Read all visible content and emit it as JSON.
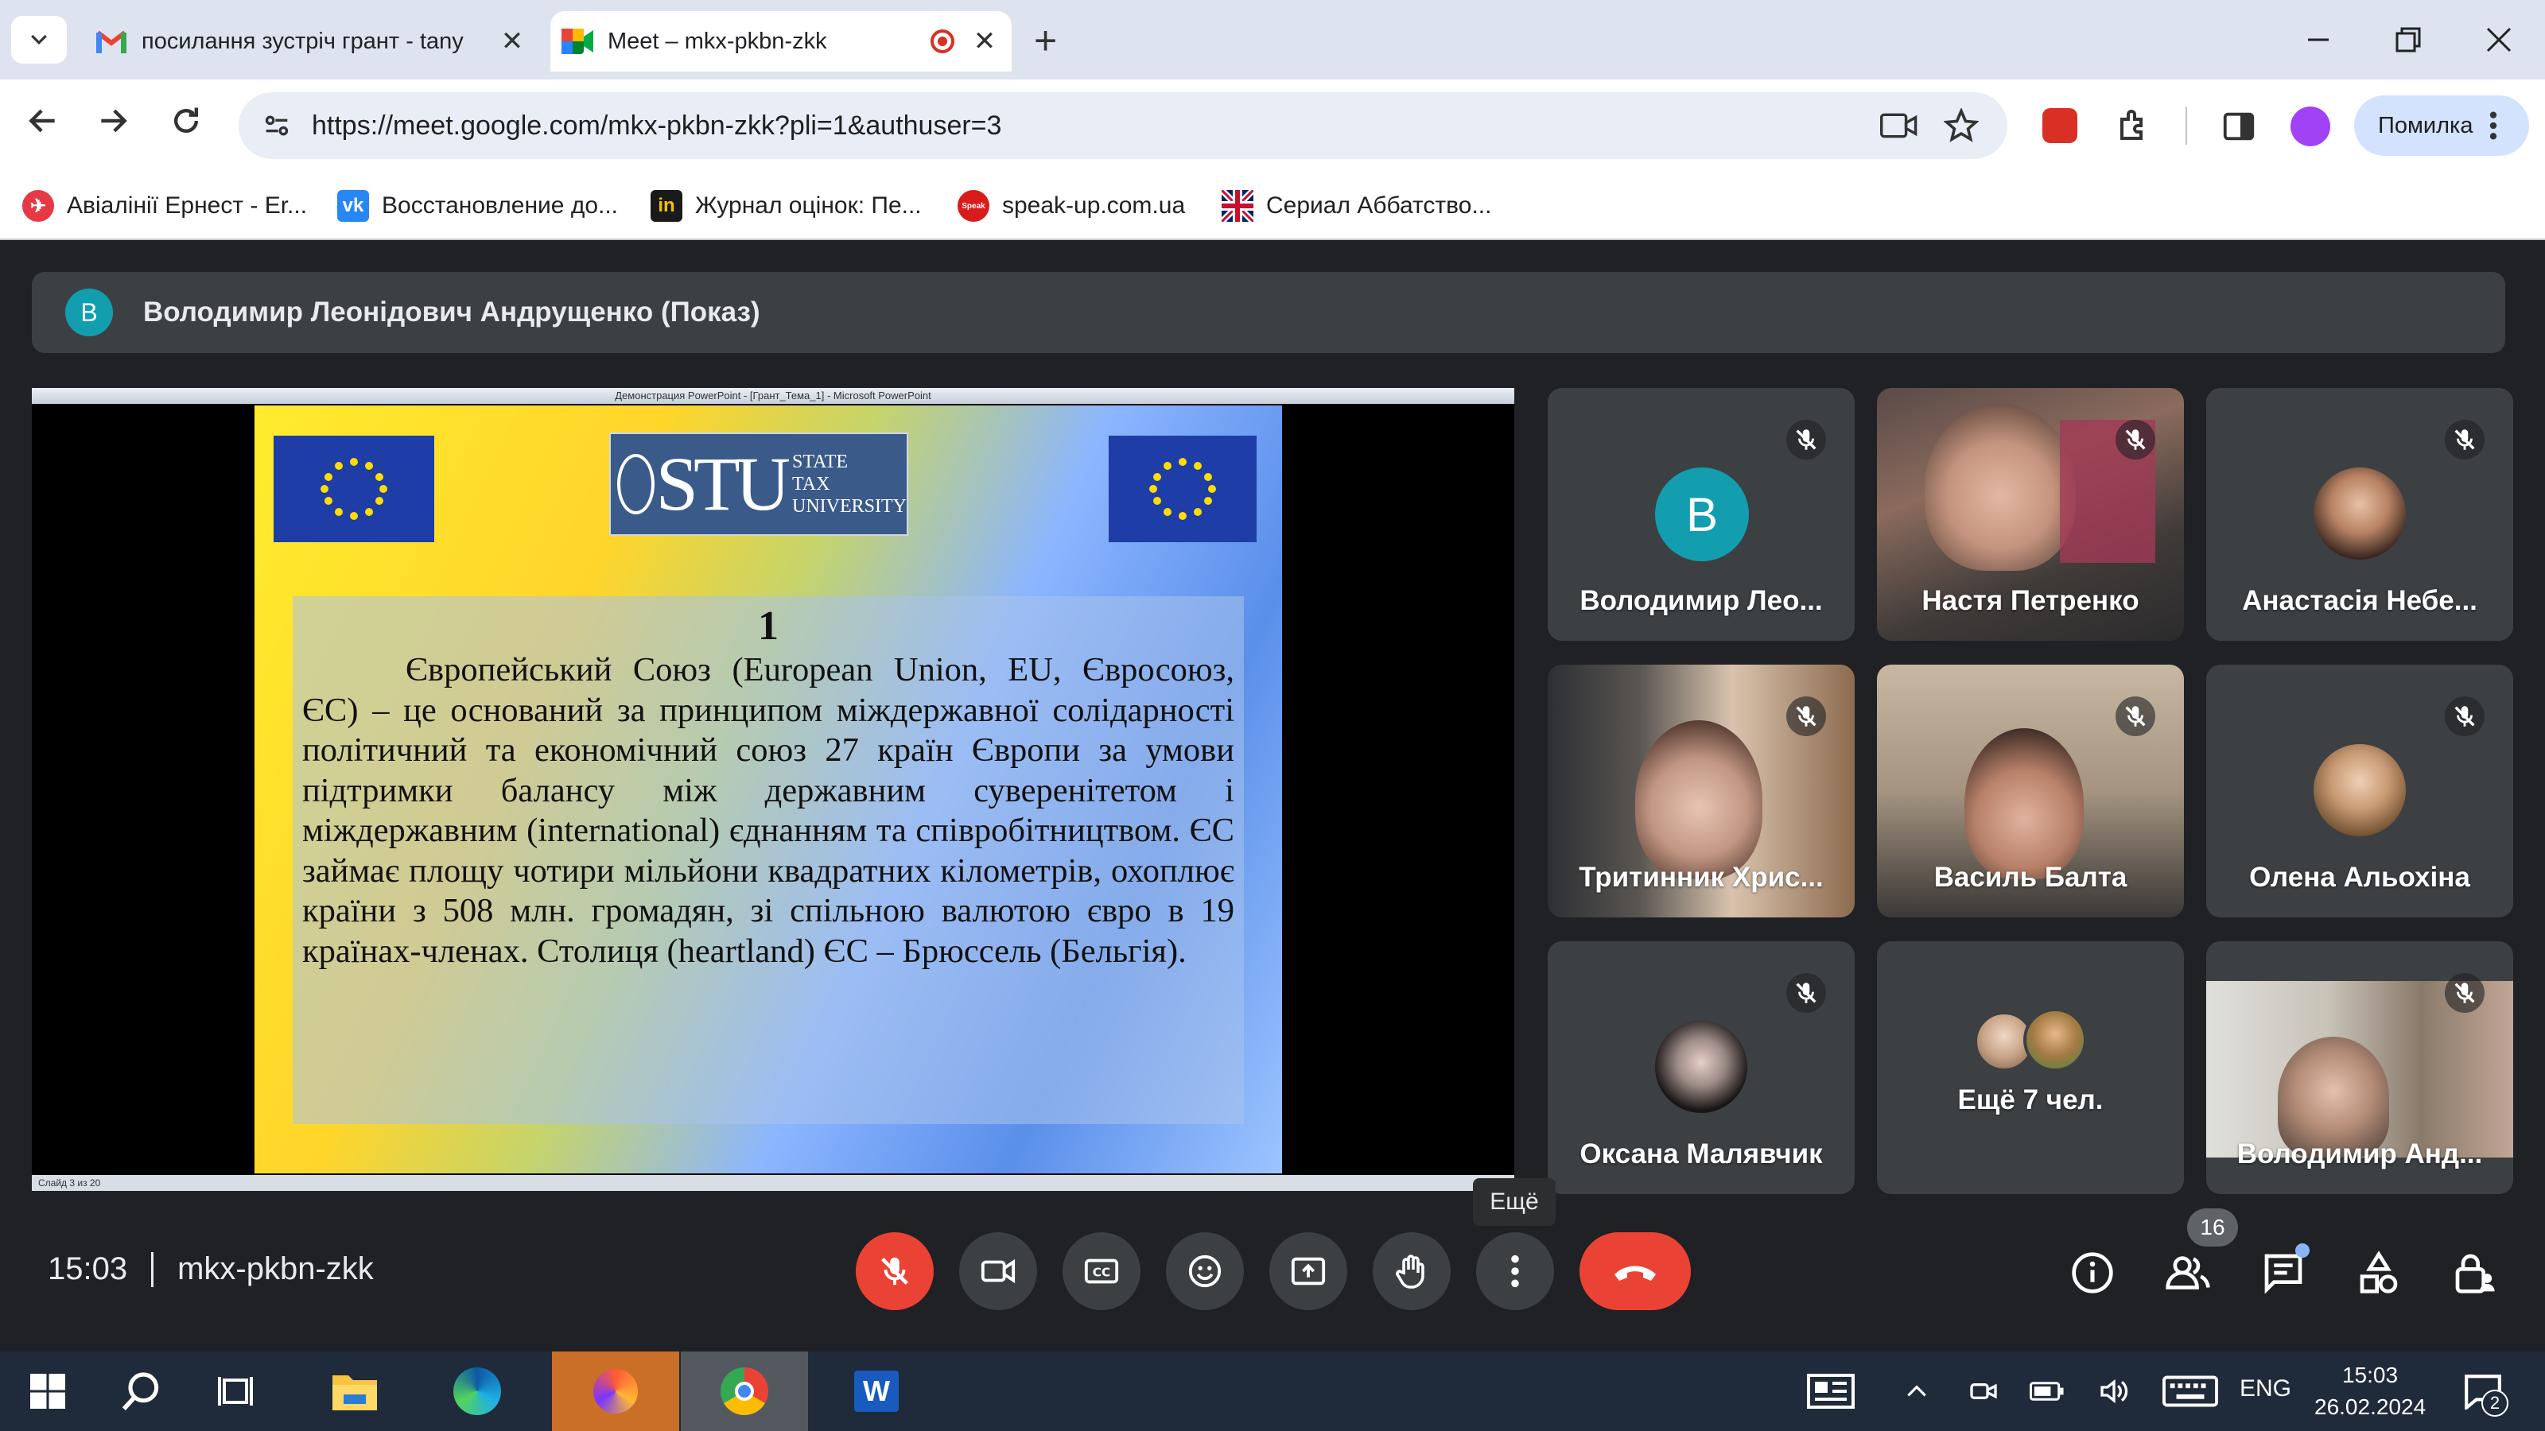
{
  "browser": {
    "tabs": [
      {
        "title": "посилання зустріч грант - tany",
        "close": "✕"
      },
      {
        "title": "Meet – mkx-pkbn-zkk",
        "close": "✕"
      }
    ],
    "new_tab": "+",
    "url": "https://meet.google.com/mkx-pkbn-zkk?pli=1&authuser=3",
    "profile_label": "Помилка",
    "bookmarks": [
      {
        "label": "Авіалінії Ернест - Er..."
      },
      {
        "label": "Восстановление до..."
      },
      {
        "label": "Журнал оцінок: Пе..."
      },
      {
        "label": "speak-up.com.ua"
      },
      {
        "label": "Сериал Аббатство..."
      }
    ]
  },
  "meet": {
    "presenter_avatar": "B",
    "presenter_title": "Володимир Леонідович Андрущенко (Показ)",
    "slide": {
      "window_title": "Демонстрация PowerPoint - [Грант_Тема_1] - Microsoft PowerPoint",
      "status_bar": "Слайд 3 из 20",
      "logo_letters": "STU",
      "logo_line1": "STATE",
      "logo_line2": "TAX",
      "logo_line3": "UNIVERSITY",
      "number": "1",
      "text": "Європейський Союз (European Union, EU, Євросоюз, ЄС) – це оснований за принципом міждержавної солідарності політичний та економічний союз 27 країн Європи за умови підтримки балансу між державним суверенітетом і міждержавним (international) єднанням та співробітництвом. ЄС займає площу чотири мільйони квадратних кілометрів, охоплює країни з 508 млн. громадян, зі спільною валютою євро в 19 країнах-членах. Столиця (heartland) ЄС – Брюссель (Бельгія)."
    },
    "participants": [
      {
        "name": "Володимир Лео...",
        "avatar": "B"
      },
      {
        "name": "Настя Петренко"
      },
      {
        "name": "Анастасія Небе..."
      },
      {
        "name": "Тритинник Хрис..."
      },
      {
        "name": "Василь Балта"
      },
      {
        "name": "Олена Альохіна"
      },
      {
        "name": "Оксана Малявчик"
      },
      {
        "name": "Ещё 7 чел."
      },
      {
        "name": "Володимир Анд..."
      }
    ],
    "time": "15:03",
    "meeting_code": "mkx-pkbn-zkk",
    "tooltip_more": "Ещё",
    "people_count": "16"
  },
  "taskbar": {
    "lang": "ENG",
    "clock_time": "15:03",
    "clock_date": "26.02.2024",
    "notif_count": "2"
  },
  "colors": {
    "end_call": "#ea4335",
    "mic_off": "#ea4335",
    "meet_bg": "#202124",
    "tile_bg": "#3c4043",
    "avatar_teal": "#129eaf"
  }
}
